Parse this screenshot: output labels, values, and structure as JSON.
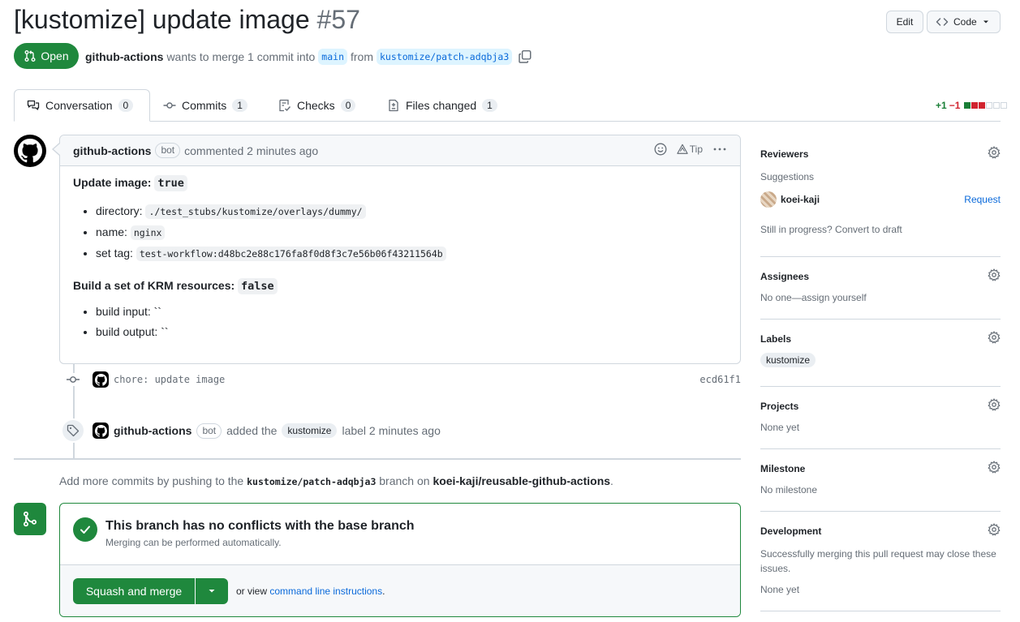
{
  "header": {
    "title": "[kustomize] update image",
    "number": "#57",
    "edit_label": "Edit",
    "code_label": "Code",
    "state": "Open",
    "author": "github-actions",
    "meta_text": "wants to merge 1 commit into",
    "base_branch": "main",
    "from_text": "from",
    "head_branch": "kustomize/patch-adqbja3"
  },
  "tabs": [
    {
      "label": "Conversation",
      "count": "0"
    },
    {
      "label": "Commits",
      "count": "1"
    },
    {
      "label": "Checks",
      "count": "0"
    },
    {
      "label": "Files changed",
      "count": "1"
    }
  ],
  "diffstat": {
    "additions": "+1",
    "deletions": "−1"
  },
  "comment": {
    "author": "github-actions",
    "badge": "bot",
    "action": "commented 2 minutes ago",
    "tip": "Tip",
    "section1_title": "Update image:",
    "section1_value": "true",
    "items1": [
      {
        "label": "directory:",
        "value": "./test_stubs/kustomize/overlays/dummy/"
      },
      {
        "label": "name:",
        "value": "nginx"
      },
      {
        "label": "set tag:",
        "value": "test-workflow:d48bc2e88c176fa8f0d8f3c7e56b06f43211564b"
      }
    ],
    "section2_title": "Build a set of KRM resources:",
    "section2_value": "false",
    "items2": [
      {
        "label": "build input:",
        "value": "``"
      },
      {
        "label": "build output:",
        "value": "``"
      }
    ]
  },
  "commit_event": {
    "message": "chore: update image",
    "sha": "ecd61f1"
  },
  "label_event": {
    "actor": "github-actions",
    "badge": "bot",
    "added_text": "added the",
    "label": "kustomize",
    "suffix": "label 2 minutes ago"
  },
  "push_note": {
    "prefix": "Add more commits by pushing to the",
    "branch": "kustomize/patch-adqbja3",
    "middle": "branch on",
    "repo": "koei-kaji/reusable-github-actions",
    "suffix": "."
  },
  "merge": {
    "title": "This branch has no conflicts with the base branch",
    "subtitle": "Merging can be performed automatically.",
    "button": "Squash and merge",
    "or_view": "or view",
    "cli_link": "command line instructions",
    "period": "."
  },
  "sidebar": {
    "reviewers": {
      "title": "Reviewers",
      "suggestions": "Suggestions",
      "user": "koei-kaji",
      "request": "Request",
      "draft_text": "Still in progress? Convert to draft"
    },
    "assignees": {
      "title": "Assignees",
      "text": "No one—assign yourself"
    },
    "labels": {
      "title": "Labels",
      "label": "kustomize"
    },
    "projects": {
      "title": "Projects",
      "text": "None yet"
    },
    "milestone": {
      "title": "Milestone",
      "text": "No milestone"
    },
    "development": {
      "title": "Development",
      "text": "Successfully merging this pull request may close these issues.",
      "none": "None yet"
    }
  },
  "colors": {
    "accent_green": "#1f883d",
    "link_blue": "#0969da",
    "branch_bg": "#ddf4ff",
    "deletion_red": "#d1242f"
  }
}
